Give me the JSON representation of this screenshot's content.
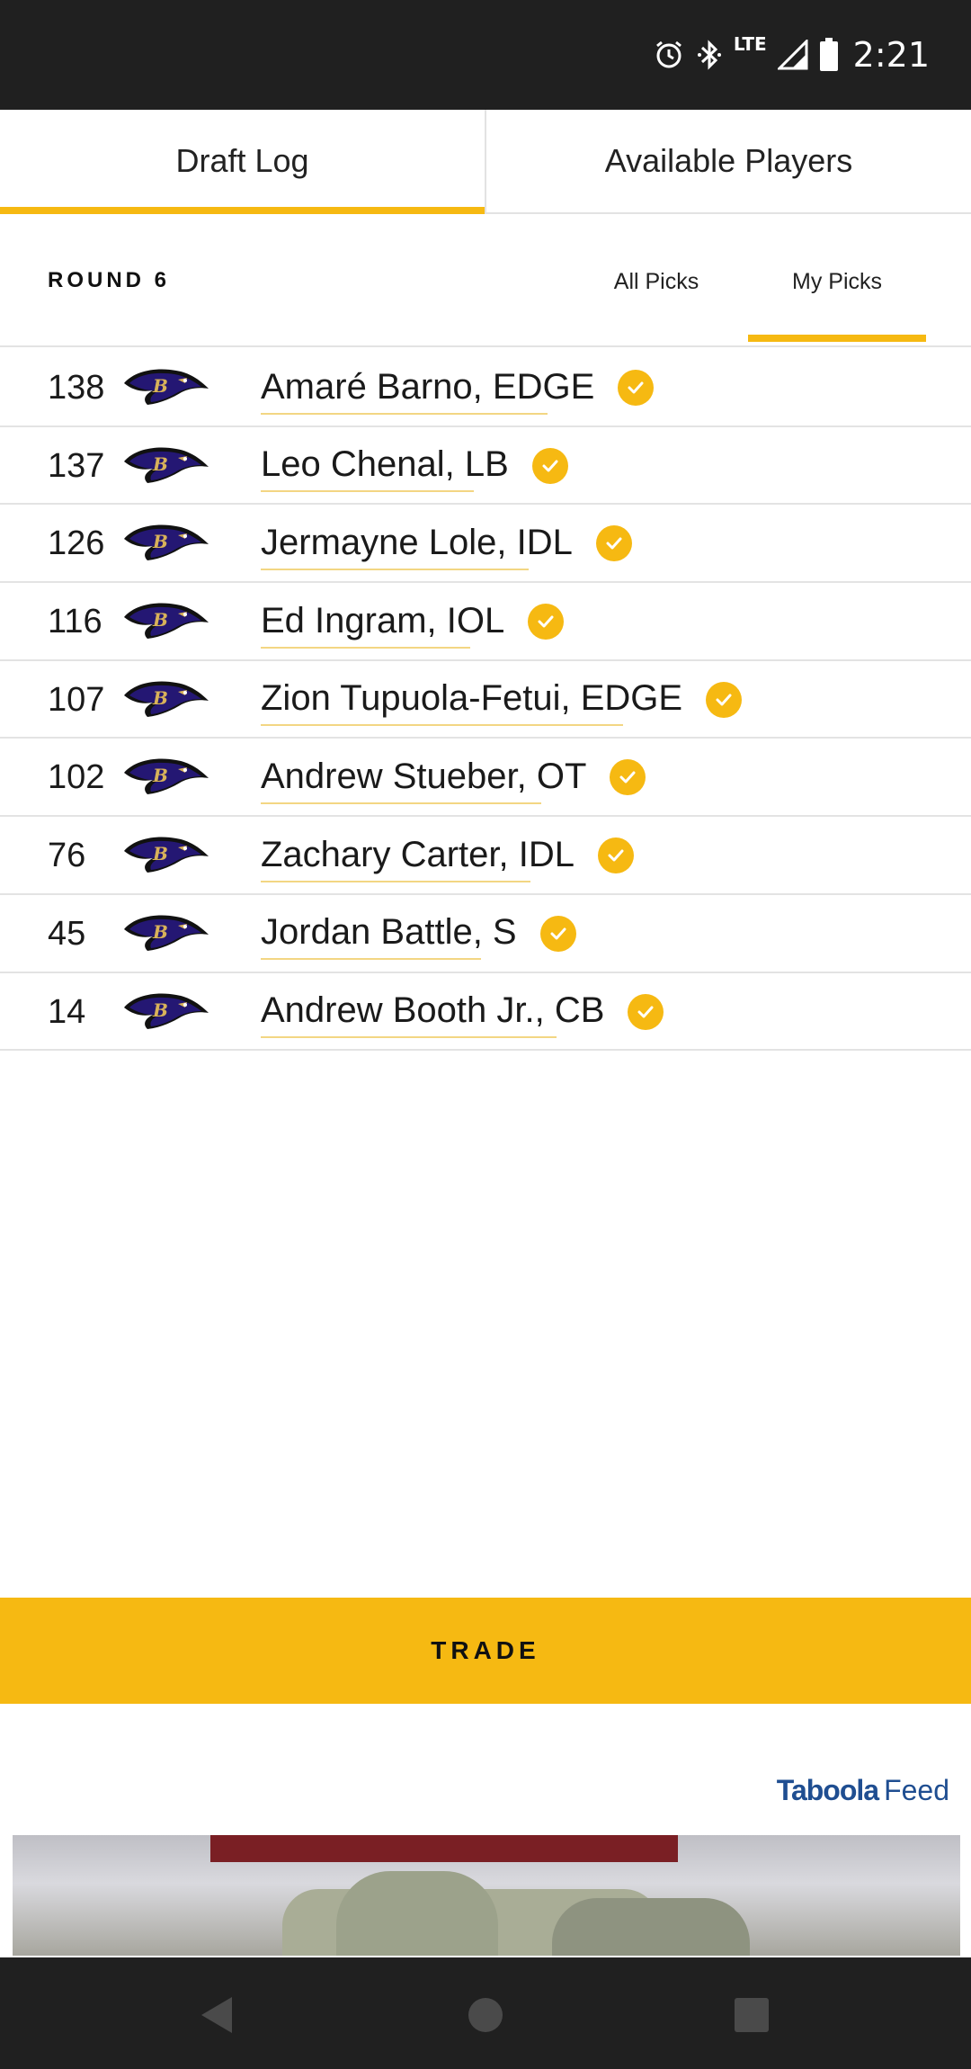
{
  "status_bar": {
    "time": "2:21",
    "network": "LTE",
    "icons": [
      "alarm-icon",
      "bluetooth-icon",
      "signal-icon",
      "battery-icon"
    ]
  },
  "tabs": [
    {
      "label": "Draft Log",
      "active": true
    },
    {
      "label": "Available Players",
      "active": false
    }
  ],
  "round": {
    "label": "ROUND 6",
    "filters": [
      {
        "label": "All Picks",
        "active": false
      },
      {
        "label": "My Picks",
        "active": true
      }
    ]
  },
  "picks": [
    {
      "number": "138",
      "player": "Amaré Barno, EDGE",
      "team_icon": "ravens-logo-icon"
    },
    {
      "number": "137",
      "player": "Leo Chenal, LB",
      "team_icon": "ravens-logo-icon"
    },
    {
      "number": "126",
      "player": "Jermayne Lole, IDL",
      "team_icon": "ravens-logo-icon"
    },
    {
      "number": "116",
      "player": "Ed Ingram, IOL",
      "team_icon": "ravens-logo-icon"
    },
    {
      "number": "107",
      "player": "Zion Tupuola-Fetui, EDGE",
      "team_icon": "ravens-logo-icon"
    },
    {
      "number": "102",
      "player": "Andrew Stueber, OT",
      "team_icon": "ravens-logo-icon"
    },
    {
      "number": "76",
      "player": "Zachary Carter, IDL",
      "team_icon": "ravens-logo-icon"
    },
    {
      "number": "45",
      "player": "Jordan Battle, S",
      "team_icon": "ravens-logo-icon"
    },
    {
      "number": "14",
      "player": "Andrew Booth Jr., CB",
      "team_icon": "ravens-logo-icon"
    }
  ],
  "trade_button": {
    "label": "TRADE"
  },
  "ad": {
    "brand": "Taboola",
    "feed_label": "Feed"
  },
  "colors": {
    "accent": "#f6b912",
    "status_bar": "#202020",
    "ravens_purple": "#241773",
    "taboola_blue": "#1f4e91"
  }
}
